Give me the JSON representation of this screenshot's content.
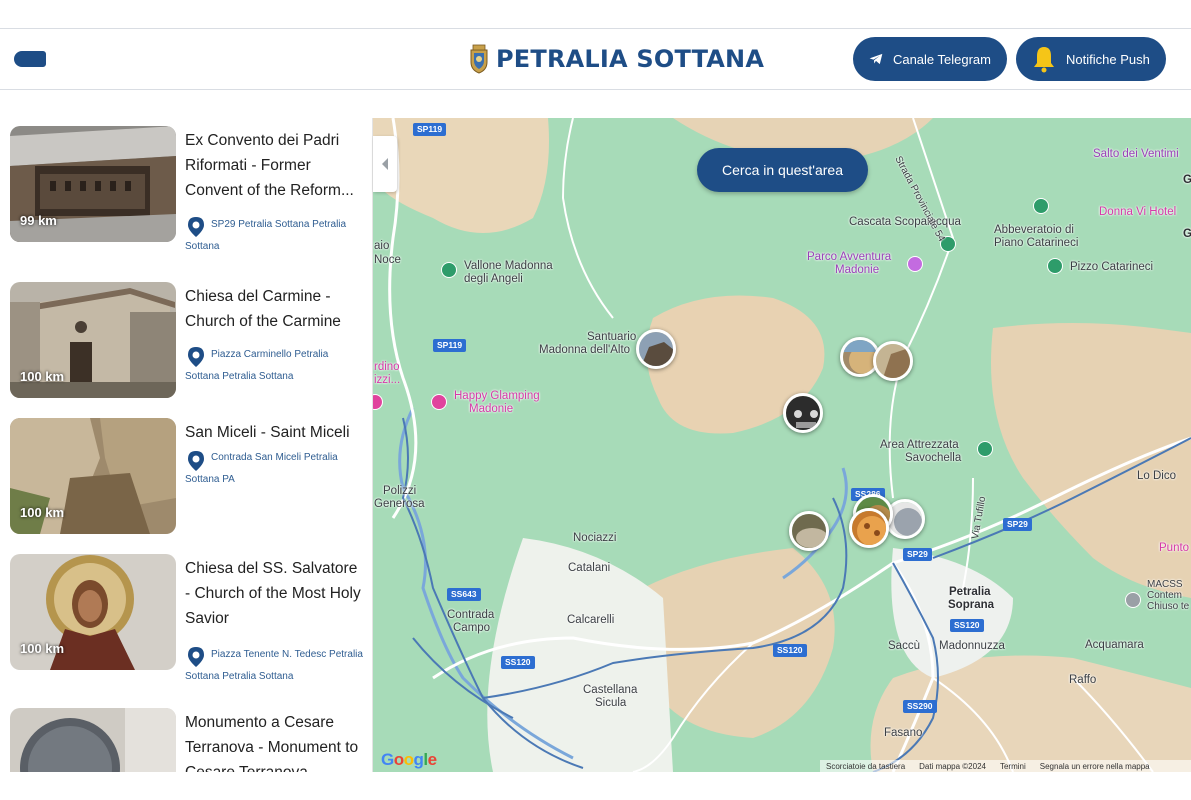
{
  "header": {
    "title": "PETRALIA SOTTANA",
    "telegram_label": "Canale Telegram",
    "push_label": "Notifiche Push",
    "accent": "#1e4d86"
  },
  "list": {
    "items": [
      {
        "title": "Ex Convento dei Padri Riformati - Former Convent of the Reform...",
        "address": "SP29 Petralia Sottana Petralia Sottana",
        "distance": "99 km",
        "icon": "map-pin-icon"
      },
      {
        "title": "Chiesa del Carmine - Church of the Carmine",
        "address": "Piazza Carminello Petralia Sottana Petralia Sottana",
        "distance": "100 km",
        "icon": "map-pin-icon"
      },
      {
        "title": "San Miceli - Saint Miceli",
        "address": "Contrada San Miceli Petralia Sottana PA",
        "distance": "100 km",
        "icon": "map-pin-icon"
      },
      {
        "title": "Chiesa del SS. Salvatore - Church of the Most Holy Savior",
        "address": "Piazza Tenente N. Tedesc Petralia Sottana Petralia Sottana",
        "distance": "100 km",
        "icon": "map-pin-icon"
      },
      {
        "title": "Monumento a Cesare Terranova - Monument to Cesare Terranova",
        "address": "",
        "distance": "",
        "icon": "map-pin-icon"
      }
    ]
  },
  "map": {
    "search_area_label": "Cerca in quest'area",
    "labels": {
      "salto": "Salto dei Ventimi",
      "donna": "Donna Vi Hotel",
      "cascata": "Cascata Scopalacqua",
      "abbeveratoio": "Abbeveratoio di",
      "piano": "Piano Catarineci",
      "parco1": "Parco Avventura",
      "parco2": "Madonie",
      "pizzo": "Pizzo Catarineci",
      "vallone1": "Vallone Madonna",
      "vallone2": "degli Angeli",
      "santuario1": "Santuario",
      "santuario2": "Madonna dell'Alto",
      "happy1": "Happy Glamping",
      "happy2": "Madonie",
      "area1": "Area Attrezzata",
      "area2": "Savochella",
      "lodico": "Lo Dico",
      "polizzi1": "Polizzi",
      "polizzi2": "Generosa",
      "nociazzi": "Nociazzi",
      "catalani": "Catalani",
      "calcarelli": "Calcarelli",
      "contrada1": "Contrada",
      "contrada2": "Campo",
      "castellana1": "Castellana",
      "castellana2": "Sicula",
      "petralia1": "Petralia",
      "petralia2": "Soprana",
      "saccu": "Saccù",
      "madonnuzza": "Madonnuzza",
      "acquamara": "Acquamara",
      "raffo": "Raffo",
      "fasano": "Fasano",
      "punto": "Punto",
      "macss1": "MACSS",
      "macss2": "Contem",
      "macss3": "Chiuso te",
      "aio": "aio",
      "noce": "Noce",
      "rdino": "rdino",
      "izzi": "izzi...",
      "strada": "Strada Provinciale 54",
      "tufillo": "Via Tufillo",
      "g1": "G",
      "g2": "G"
    },
    "roads": [
      "SP119",
      "SP119",
      "SS643",
      "SS120",
      "SS120",
      "SS120",
      "SS290",
      "SP29",
      "SP29",
      "SS286"
    ],
    "google": "Google",
    "attribution": [
      "Scorciatoie da tastiera",
      "Dati mappa ©2024",
      "Termini",
      "Segnala un errore nella mappa"
    ]
  }
}
